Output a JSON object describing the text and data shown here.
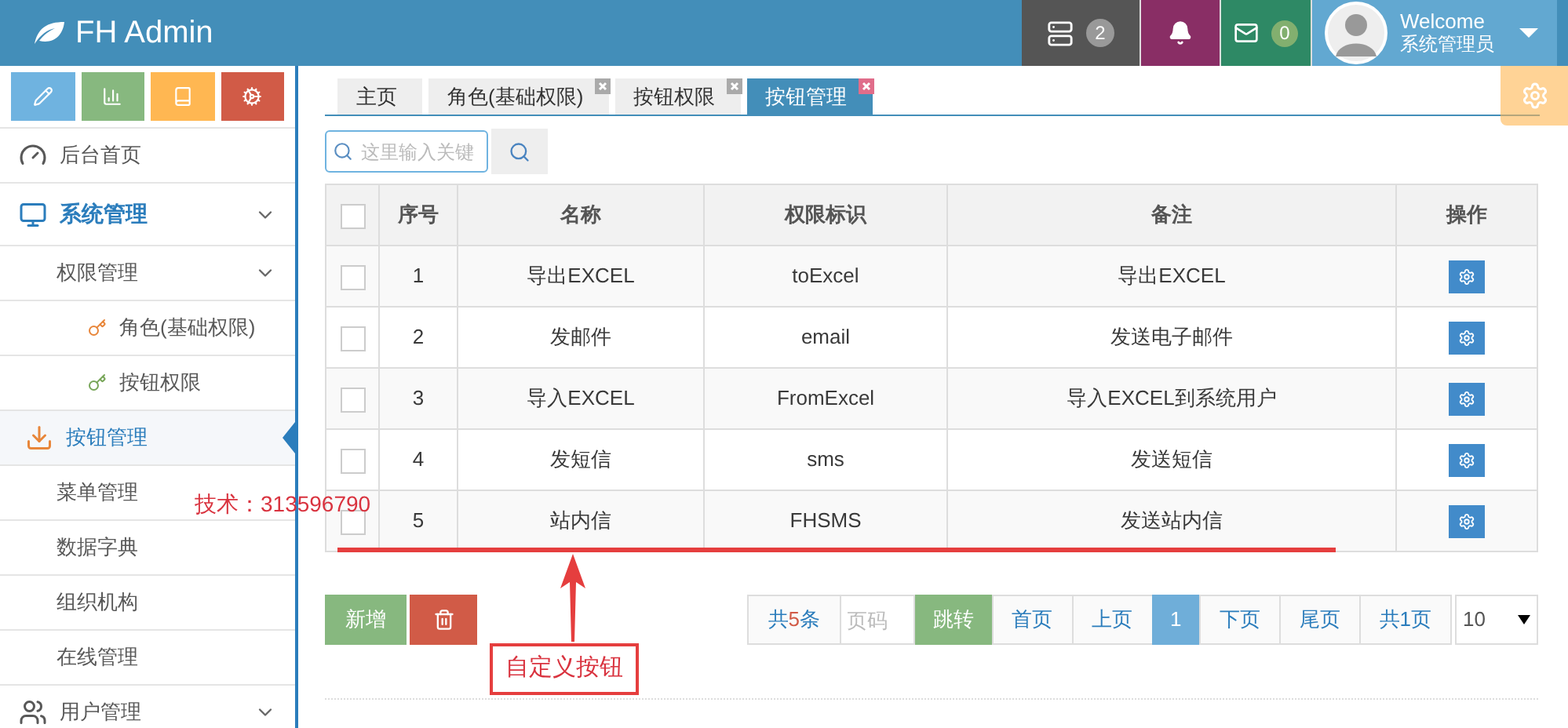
{
  "header": {
    "brand": "FH Admin",
    "tasks_count": "2",
    "messages_count": "0",
    "welcome": "Welcome",
    "user": "系统管理员"
  },
  "sidebar": {
    "items": [
      {
        "label": "后台首页",
        "kind": "dashboard",
        "expanded": false,
        "selected": false
      },
      {
        "label": "系统管理",
        "kind": "desktop",
        "expanded": true,
        "selected": false,
        "children": [
          {
            "label": "权限管理",
            "kind": "plain",
            "expanded": true,
            "selected": false,
            "children": [
              {
                "label": "角色(基础权限)",
                "kind": "key",
                "color": "#e8863a",
                "expanded": false,
                "selected": false
              },
              {
                "label": "按钮权限",
                "kind": "key",
                "color": "#78a659",
                "expanded": false,
                "selected": false
              }
            ]
          },
          {
            "label": "按钮管理",
            "kind": "download",
            "expanded": false,
            "selected": true
          },
          {
            "label": "菜单管理",
            "kind": "plain",
            "expanded": false,
            "selected": false
          },
          {
            "label": "数据字典",
            "kind": "plain",
            "expanded": false,
            "selected": false
          },
          {
            "label": "组织机构",
            "kind": "plain",
            "expanded": false,
            "selected": false
          },
          {
            "label": "在线管理",
            "kind": "plain",
            "expanded": false,
            "selected": false
          }
        ]
      },
      {
        "label": "用户管理",
        "kind": "users",
        "expanded": false,
        "selected": false
      }
    ]
  },
  "tabs": [
    {
      "label": "主页",
      "closable": false,
      "selected": false
    },
    {
      "label": "角色(基础权限)",
      "closable": true,
      "selected": false
    },
    {
      "label": "按钮权限",
      "closable": true,
      "selected": false
    },
    {
      "label": "按钮管理",
      "closable": true,
      "selected": true
    }
  ],
  "search": {
    "placeholder": "这里输入关键"
  },
  "table": {
    "select_all_checked": false,
    "columns": [
      "序号",
      "名称",
      "权限标识",
      "备注",
      "操作"
    ],
    "rows": [
      {
        "checked": false,
        "cells": [
          "1",
          "导出EXCEL",
          "toExcel",
          "导出EXCEL"
        ]
      },
      {
        "checked": false,
        "cells": [
          "2",
          "发邮件",
          "email",
          "发送电子邮件"
        ]
      },
      {
        "checked": false,
        "cells": [
          "3",
          "导入EXCEL",
          "FromExcel",
          "导入EXCEL到系统用户"
        ]
      },
      {
        "checked": false,
        "cells": [
          "4",
          "发短信",
          "sms",
          "发送短信"
        ]
      },
      {
        "checked": false,
        "cells": [
          "5",
          "站内信",
          "FHSMS",
          "发送站内信"
        ]
      }
    ]
  },
  "actions": {
    "add": "新增"
  },
  "pager": {
    "total_before": "共",
    "total_count": "5",
    "total_after": "条",
    "page_placeholder": "页码",
    "go": "跳转",
    "first": "首页",
    "prev": "上页",
    "current": "1",
    "next": "下页",
    "last": "尾页",
    "pages": "共1页",
    "page_size": "10"
  },
  "annotations": {
    "contact": "技术：313596790",
    "callout": "自定义按钮"
  }
}
